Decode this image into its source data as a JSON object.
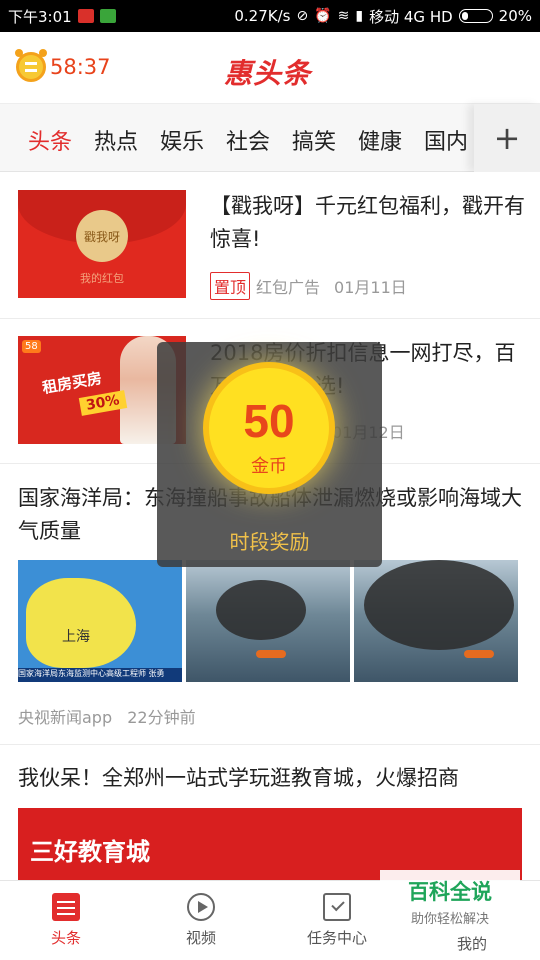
{
  "status_bar": {
    "time": "下午3:01",
    "speed": "0.27K/s",
    "carrier": "移动 4G HD",
    "battery": "20%"
  },
  "header": {
    "timer": "58:37",
    "logo": "惠头条"
  },
  "tabs": [
    "头条",
    "热点",
    "娱乐",
    "社会",
    "搞笑",
    "健康",
    "国内"
  ],
  "add_tab_icon": "plus-icon",
  "feed": [
    {
      "title": "【戳我呀】千元红包福利，戳开有惊喜!",
      "tag": "置顶",
      "source": "红包广告",
      "date": "01月11日",
      "thumb_seal": "戳我呀",
      "thumb_sub": "我的红包"
    },
    {
      "title": "2018房价折扣信息一网打尽，百万房源等你选!",
      "date": "01月12日",
      "thumb_brand": "58",
      "thumb_text": "租房买房",
      "thumb_badge": "30%"
    },
    {
      "title": "国家海洋局：东海撞船事故船体泄漏燃烧或影响海域大气质量",
      "map_label": "上海",
      "caption": "国家海洋局东海监测中心高级工程师 张勇",
      "source": "央视新闻app",
      "time": "22分钟前"
    },
    {
      "title": "我伙呆！全郑州一站式学玩逛教育城，火爆招商",
      "banner_text": "三好教育城"
    }
  ],
  "popup": {
    "amount": "50",
    "unit": "金币",
    "label": "时段奖励"
  },
  "bottom_nav": [
    {
      "label": "头条",
      "icon": "news-icon"
    },
    {
      "label": "视频",
      "icon": "play-icon"
    },
    {
      "label": "任务中心",
      "icon": "calendar-check-icon"
    },
    {
      "label": "我的",
      "icon": "user-icon"
    }
  ],
  "watermark": {
    "title": "百科全说",
    "subtitle": "助你轻松解决"
  },
  "colors": {
    "brand_red": "#e22d2d",
    "timer_orange": "#e8431b",
    "coin_gold": "#ffe021"
  }
}
